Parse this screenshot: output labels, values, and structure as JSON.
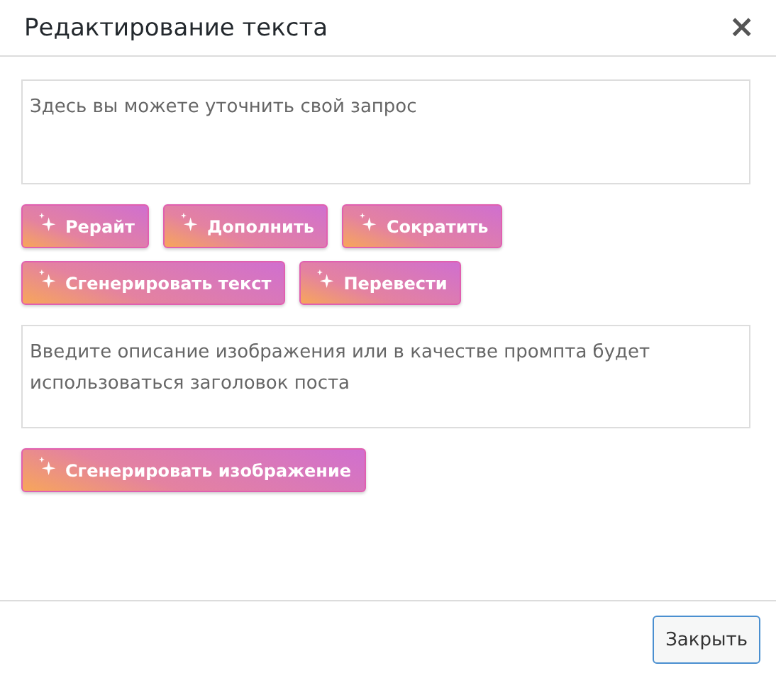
{
  "dialog": {
    "title": "Редактирование текста",
    "close_glyph": "×"
  },
  "refine_field": {
    "placeholder": "Здесь вы можете уточнить свой запрос"
  },
  "text_actions": [
    {
      "label": "Рерайт"
    },
    {
      "label": "Дополнить"
    },
    {
      "label": "Сократить"
    },
    {
      "label": "Сгенерировать текст"
    },
    {
      "label": "Перевести"
    }
  ],
  "image_field": {
    "placeholder": "Введите описание изображения или в качестве промпта будет использоваться заголовок поста"
  },
  "image_action": {
    "label": "Сгенерировать изображение"
  },
  "footer": {
    "close_button": "Закрыть"
  }
}
